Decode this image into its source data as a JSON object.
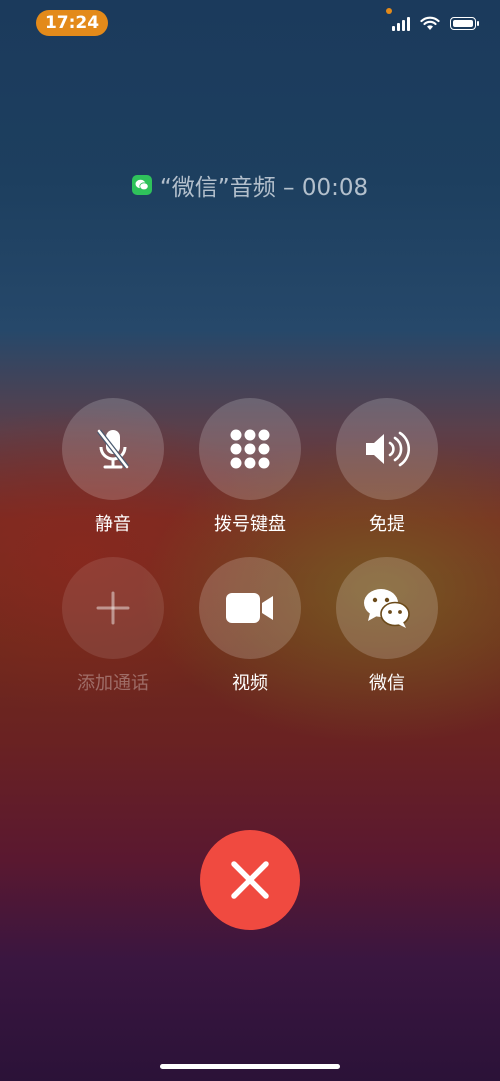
{
  "status_bar": {
    "time": "17:24",
    "icons": [
      "cellular-signal-icon",
      "wifi-icon",
      "battery-icon"
    ]
  },
  "call": {
    "app_icon": "wechat-icon",
    "title": "“微信”音频 – 00:08"
  },
  "controls": [
    {
      "id": "mute",
      "label": "静音",
      "icon": "mute-mic-icon",
      "enabled": true
    },
    {
      "id": "keypad",
      "label": "拨号键盘",
      "icon": "keypad-icon",
      "enabled": true
    },
    {
      "id": "speaker",
      "label": "免提",
      "icon": "speaker-icon",
      "enabled": true
    },
    {
      "id": "add_call",
      "label": "添加通话",
      "icon": "plus-icon",
      "enabled": false
    },
    {
      "id": "video",
      "label": "视频",
      "icon": "video-camera-icon",
      "enabled": true
    },
    {
      "id": "wechat",
      "label": "微信",
      "icon": "wechat-icon",
      "enabled": true
    }
  ],
  "end_call": {
    "icon": "close-icon",
    "color": "#f04a40"
  },
  "colors": {
    "time_pill": "#e38a1a",
    "wechat_green": "#2fc25b"
  }
}
